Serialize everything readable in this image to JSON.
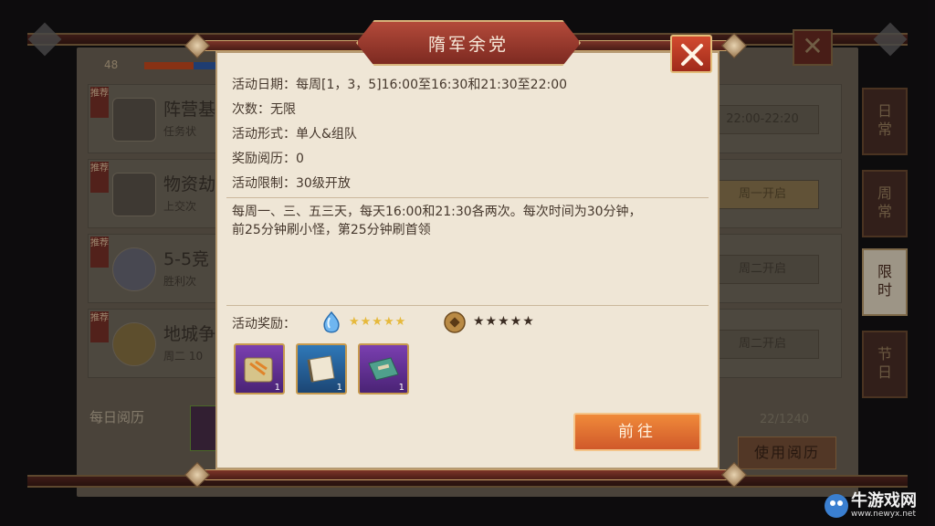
{
  "background": {
    "level": "48",
    "rows": [
      {
        "tag": "推荐",
        "title": "阵营基",
        "subtitle": "任务状",
        "right": "22:00-22:20"
      },
      {
        "tag": "推荐",
        "title": "物资劫",
        "subtitle": "上交次",
        "right": "周一开启"
      },
      {
        "tag": "推荐",
        "title": "5-5竞",
        "subtitle": "胜利次",
        "right": "周二开启"
      },
      {
        "tag": "推荐",
        "title": "地城争",
        "subtitle": "周二 10",
        "right": "周二开启"
      }
    ],
    "daily_label": "每日阅历",
    "daily_count": "22/1240",
    "use_button": "使用阅历",
    "side_tabs": [
      "日常",
      "周常",
      "限时",
      "节日"
    ],
    "active_tab": "限时"
  },
  "modal": {
    "title": "隋军余党",
    "info": [
      "活动日期：每周[1，3，5]16:00至16:30和21:30至22:00",
      "次数：无限",
      "活动形式：单人&组队",
      "奖励阅历：0",
      "活动限制：30级开放"
    ],
    "description_line1": "每周一、三、五三天，每天16:00和21:30各两次。每次时间为30分钟，",
    "description_line2": "前25分钟刷小怪，第25分钟刷首领",
    "reward_label": "活动奖励：",
    "gem_stars": "★★★★★",
    "coin_stars": "★★★★★",
    "items": [
      {
        "name": "treasure-map-item",
        "qty": "1",
        "rarity": "purple"
      },
      {
        "name": "scroll-book-item",
        "qty": "1",
        "rarity": "blue"
      },
      {
        "name": "skill-book-item",
        "qty": "1",
        "rarity": "purple"
      }
    ],
    "goto_button": "前往"
  },
  "watermark": {
    "text": "牛游戏网",
    "url": "www.newyx.net"
  },
  "colors": {
    "accent": "#d0592a",
    "title_plate": "#9c3a2e",
    "parchment": "#efe6d6"
  }
}
